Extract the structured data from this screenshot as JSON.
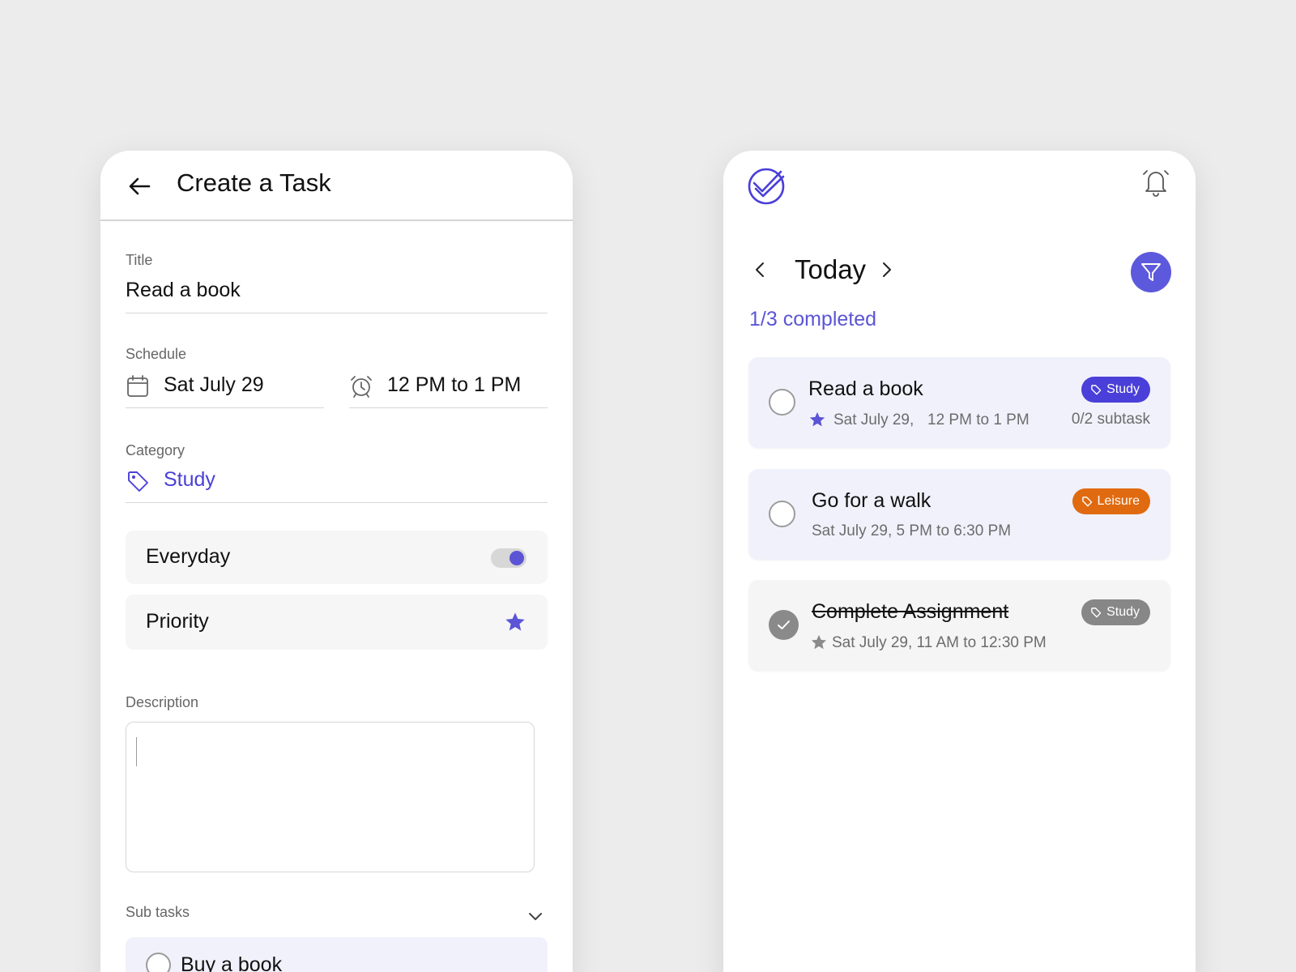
{
  "create_task": {
    "title": "Create a Task",
    "fields": {
      "title_label": "Title",
      "title_value": "Read a book",
      "schedule_label": "Schedule",
      "date_value": "Sat July 29",
      "time_value": "12 PM to 1 PM",
      "category_label": "Category",
      "category_value": "Study"
    },
    "everyday_label": "Everyday",
    "everyday_on": true,
    "priority_label": "Priority",
    "description_label": "Description",
    "description_value": "",
    "subtasks_label": "Sub tasks",
    "subtasks": [
      {
        "label": "Buy a book"
      }
    ]
  },
  "today_view": {
    "heading": "Today",
    "completed_text": "1/3 completed",
    "tasks": [
      {
        "title": "Read a book",
        "meta_date": "Sat July 29,",
        "meta_time": "12 PM to 1 PM",
        "subtask": "0/2 subtask",
        "tag": "Study",
        "tag_color": "#4a3fd8",
        "priority": true,
        "done": false,
        "bg": "#f1f1fc"
      },
      {
        "title": "Go for a walk",
        "meta": "Sat July 29, 5 PM to 6:30 PM",
        "tag": "Leisure",
        "tag_color": "#e06a10",
        "priority": false,
        "done": false,
        "bg": "#f1f1fc"
      },
      {
        "title": "Complete Assignment",
        "meta": "Sat July 29, 11 AM to 12:30 PM",
        "tag": "Study",
        "tag_color": "#878787",
        "priority": true,
        "done": true,
        "bg": "#f5f5f5"
      }
    ]
  },
  "colors": {
    "accent": "#5b55d6",
    "background": "#ececec"
  },
  "icons": [
    "arrow-left-icon",
    "calendar-icon",
    "alarm-clock-icon",
    "tag-icon",
    "star-icon",
    "chevron-down-icon",
    "check-logo-icon",
    "bell-icon",
    "chevron-left-icon",
    "chevron-right-icon",
    "filter-icon",
    "check-icon"
  ]
}
